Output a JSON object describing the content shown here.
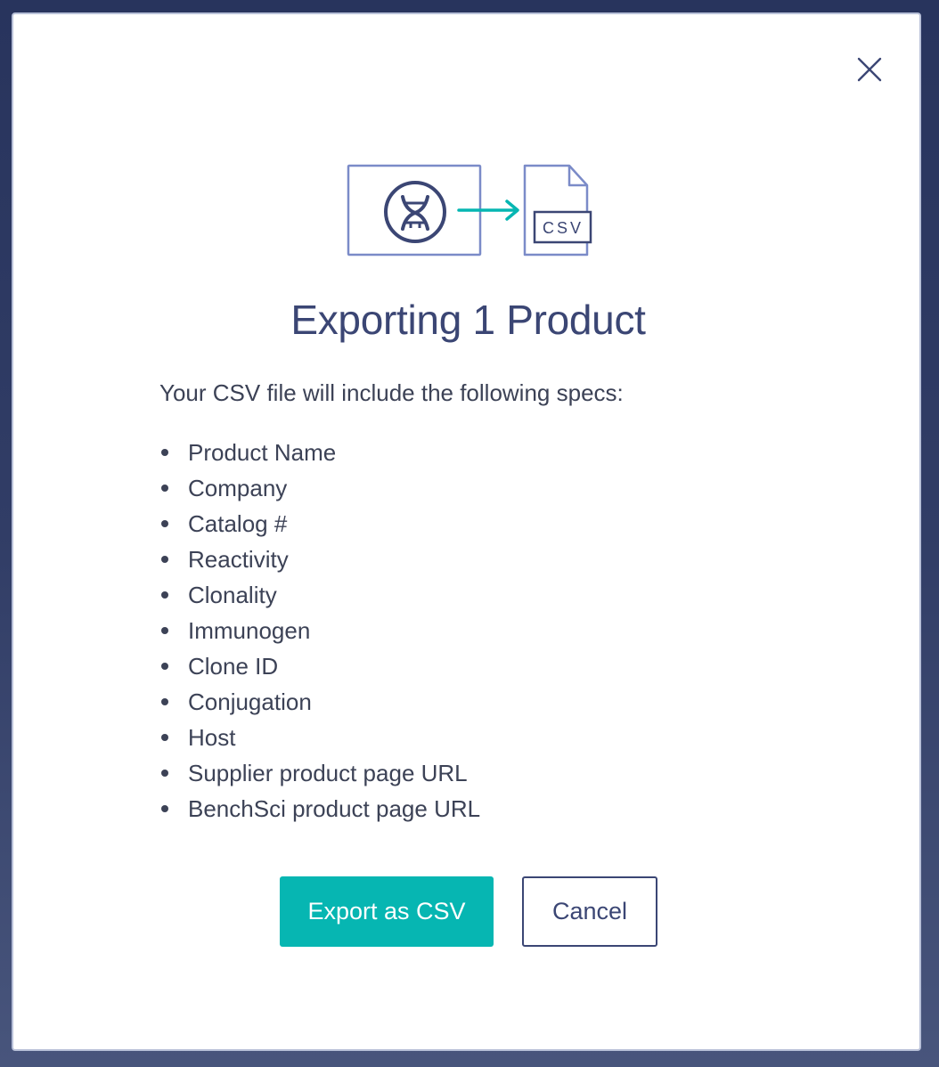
{
  "modal": {
    "title": "Exporting 1 Product",
    "intro": "Your CSV file will include the following specs:",
    "specs": [
      "Product Name",
      "Company",
      "Catalog #",
      "Reactivity",
      "Clonality",
      "Immunogen",
      "Clone ID",
      "Conjugation",
      "Host",
      "Supplier product page URL",
      "BenchSci product page URL"
    ],
    "illustration": {
      "csv_label": "CSV",
      "icons": [
        "product-card-icon",
        "arrow-right-icon",
        "csv-file-icon"
      ]
    },
    "buttons": {
      "export_label": "Export as CSV",
      "cancel_label": "Cancel"
    },
    "close_icon": "close-icon"
  },
  "colors": {
    "primary": "#06b6b2",
    "heading": "#3b4674",
    "text": "#3c4256",
    "illustration_stroke": "#7b8bc8",
    "backdrop": "#2b375f"
  }
}
